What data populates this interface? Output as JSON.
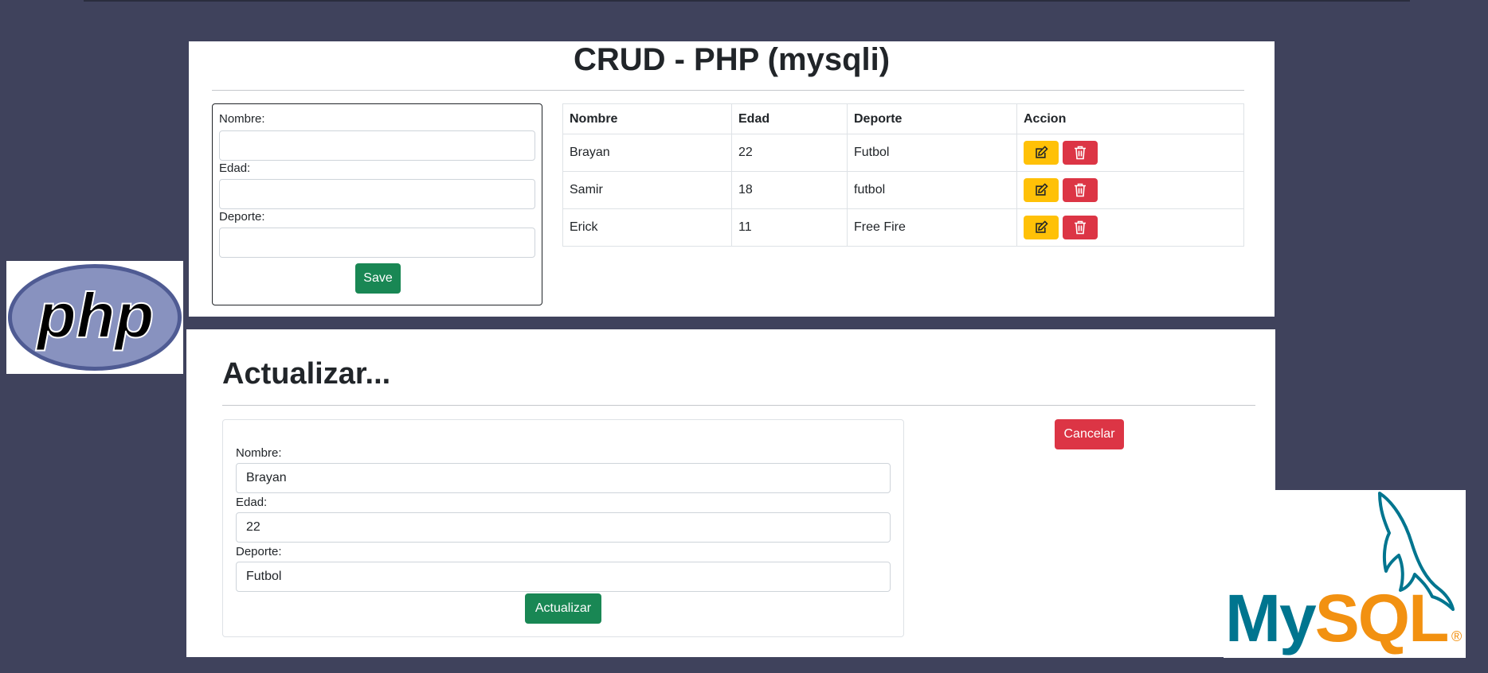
{
  "crud": {
    "title": "CRUD - PHP (mysqli)",
    "form": {
      "nombre_label": "Nombre:",
      "edad_label": "Edad:",
      "deporte_label": "Deporte:",
      "nombre_value": "",
      "edad_value": "",
      "deporte_value": "",
      "save_label": "Save"
    },
    "table": {
      "headers": [
        "Nombre",
        "Edad",
        "Deporte",
        "Accion"
      ],
      "rows": [
        {
          "nombre": "Brayan",
          "edad": "22",
          "deporte": "Futbol"
        },
        {
          "nombre": "Samir",
          "edad": "18",
          "deporte": "futbol"
        },
        {
          "nombre": "Erick",
          "edad": "11",
          "deporte": "Free Fire"
        }
      ]
    }
  },
  "update": {
    "heading": "Actualizar...",
    "cancel_label": "Cancelar",
    "form": {
      "nombre_label": "Nombre:",
      "edad_label": "Edad:",
      "deporte_label": "Deporte:",
      "nombre_value": "Brayan",
      "edad_value": "22",
      "deporte_value": "Futbol",
      "submit_label": "Actualizar"
    }
  },
  "logos": {
    "php": "php",
    "mysql": "MySQL"
  },
  "icons": {
    "edit": "edit-icon",
    "delete": "trash-icon"
  },
  "colors": {
    "background": "#3f425c",
    "success": "#198754",
    "danger": "#dc3545",
    "warning": "#ffc107"
  }
}
